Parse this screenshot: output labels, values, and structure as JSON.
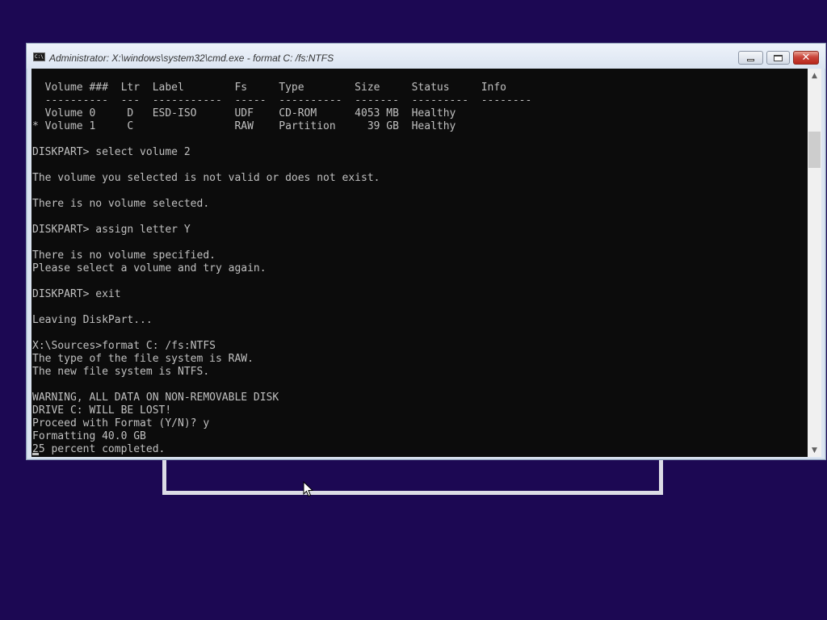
{
  "window": {
    "title": "Administrator: X:\\windows\\system32\\cmd.exe - format  C: /fs:NTFS",
    "icon": "cmd-console-icon",
    "icon_text": "C:\\",
    "controls": {
      "minimize_icon": "minimize-icon",
      "maximize_icon": "maximize-icon",
      "close_icon": "close-icon",
      "close_glyph": "✕"
    }
  },
  "console": {
    "lines": [
      "",
      "  Volume ###  Ltr  Label        Fs     Type        Size     Status     Info",
      "  ----------  ---  -----------  -----  ----------  -------  ---------  --------",
      "  Volume 0     D   ESD-ISO      UDF    CD-ROM      4053 MB  Healthy",
      "* Volume 1     C                RAW    Partition     39 GB  Healthy",
      "",
      "DISKPART> select volume 2",
      "",
      "The volume you selected is not valid or does not exist.",
      "",
      "There is no volume selected.",
      "",
      "DISKPART> assign letter Y",
      "",
      "There is no volume specified.",
      "Please select a volume and try again.",
      "",
      "DISKPART> exit",
      "",
      "Leaving DiskPart...",
      "",
      "X:\\Sources>format C: /fs:NTFS",
      "The type of the file system is RAW.",
      "The new file system is NTFS.",
      "",
      "WARNING, ALL DATA ON NON-REMOVABLE DISK",
      "DRIVE C: WILL BE LOST!",
      "Proceed with Format (Y/N)? y",
      "Formatting 40.0 GB",
      "25 percent completed."
    ],
    "text_color": "#c0c0c0",
    "background_color": "#0c0c0c"
  },
  "scrollbar": {
    "up_arrow": "▲",
    "down_arrow": "▼"
  },
  "desktop": {
    "background_color": "#1c0853",
    "pointer_icon": "mouse-pointer-icon"
  }
}
